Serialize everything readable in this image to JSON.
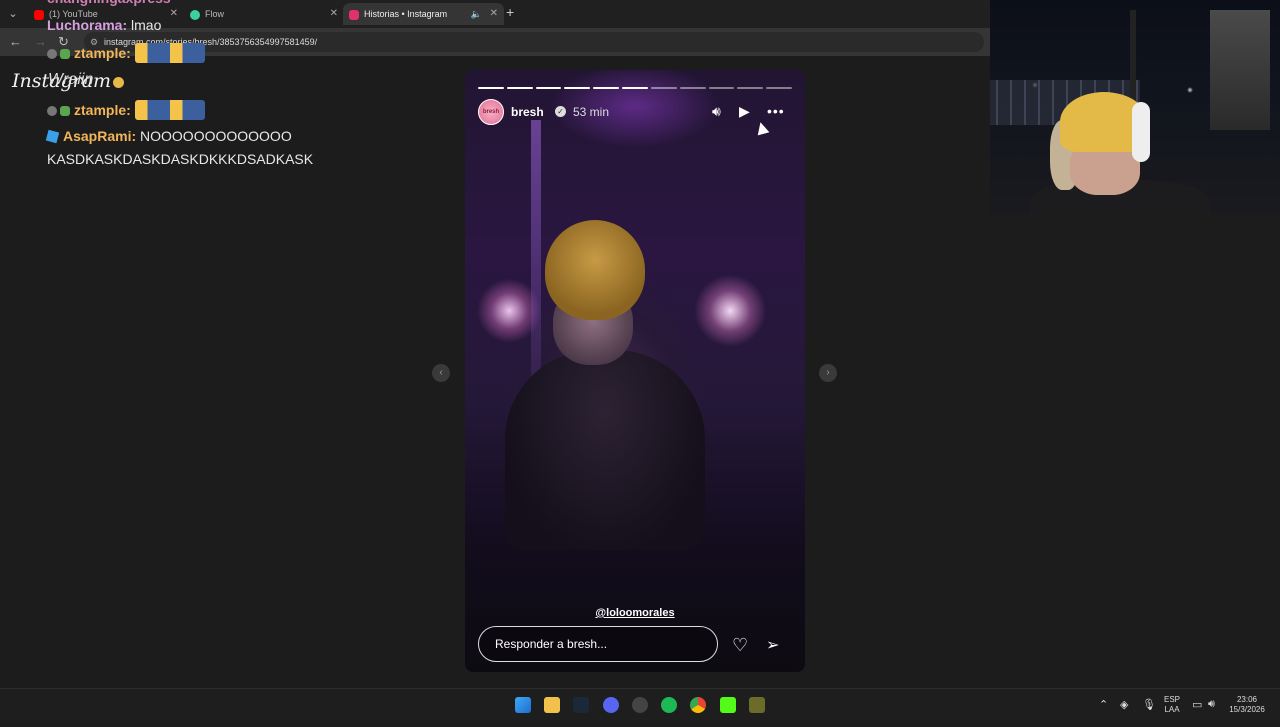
{
  "tabs": [
    {
      "title": "(1) YouTube",
      "color": "#ff0000"
    },
    {
      "title": "Flow",
      "color": "#3bd0a0"
    },
    {
      "title": "Historias • Instagram",
      "color": "#e1306c",
      "active": true
    }
  ],
  "address": {
    "url": "instagram.com/stories/bresh/3853756354997581459/"
  },
  "chat": {
    "top_partial": "changhingaxpress",
    "messages": [
      {
        "user": "Luchorama",
        "text": "lmao",
        "color": "#d6a0e0"
      },
      {
        "user": "ztample",
        "text": "",
        "color": "#f2b55a"
      },
      {
        "user": "ztample",
        "text": "",
        "color": "#f2b55a"
      },
      {
        "user": "AsapRami",
        "text": "NOOOOOOOOOOOOO",
        "color": "#f2b55a"
      }
    ],
    "wrap_line": "KASDKASKDASKDASKDKKKDSADKASK",
    "overlay_logo": "Instagram",
    "overlay_name": "Wraiin"
  },
  "story": {
    "username": "bresh",
    "time": "53 min",
    "mention": "@loloomorales",
    "reply_placeholder": "Responder a bresh...",
    "progress_total": 11,
    "progress_done": 6,
    "avatar_text": "bresh"
  },
  "icons": {
    "mute": "speaker-icon",
    "play": "play-icon",
    "more": "more-icon",
    "like": "heart-icon",
    "share": "send-icon"
  },
  "taskbar": {
    "lang": "ESP",
    "lang2": "LAA",
    "time": "23:06",
    "date": "15/3/2026"
  }
}
